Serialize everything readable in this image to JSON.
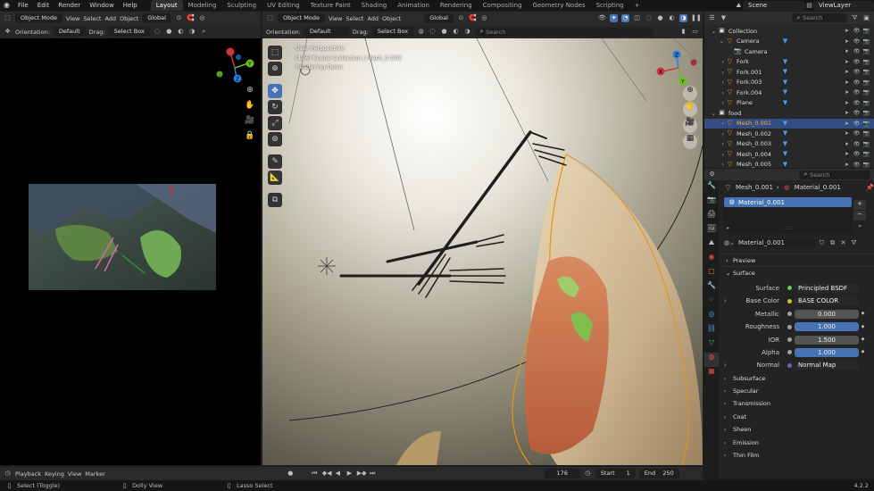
{
  "topbar": {
    "menus": [
      "File",
      "Edit",
      "Render",
      "Window",
      "Help"
    ],
    "workspaces": [
      "Layout",
      "Modeling",
      "Sculpting",
      "UV Editing",
      "Texture Paint",
      "Shading",
      "Animation",
      "Rendering",
      "Compositing",
      "Geometry Nodes",
      "Scripting"
    ],
    "active_workspace": "Layout",
    "add_tab": "+",
    "scene": "Scene",
    "view_layer": "ViewLayer"
  },
  "left_viewport": {
    "mode": "Object Mode",
    "menus": [
      "View",
      "Select",
      "Add",
      "Object"
    ],
    "transform_orientation": "Global",
    "orientation_label": "Orientation:",
    "orientation_value": "Default",
    "drag_label": "Drag:",
    "drag_value": "Select Box",
    "gizmo_axes": [
      "X",
      "Y",
      "Z"
    ]
  },
  "main_viewport": {
    "mode": "Object Mode",
    "menus": [
      "View",
      "Select",
      "Add",
      "Object"
    ],
    "transform_orientation": "Global",
    "orientation_label": "Orientation:",
    "orientation_value": "Default",
    "drag_label": "Drag:",
    "drag_value": "Select Box",
    "search_placeholder": "Search",
    "overlay_line1": "User Perspective",
    "overlay_line2": "(176) Scene Collection | Mesh_0.001",
    "overlay_line3": "Rendering Done",
    "gizmo_axes": [
      "X",
      "Y",
      "Z"
    ]
  },
  "outliner": {
    "search_placeholder": "Search",
    "rows": [
      {
        "label": "Collection",
        "indent": 1
      },
      {
        "label": "Camera",
        "indent": 2
      },
      {
        "label": "Camera",
        "indent": 3
      },
      {
        "label": "Fork",
        "indent": 2
      },
      {
        "label": "Fork.001",
        "indent": 2
      },
      {
        "label": "Fork.003",
        "indent": 2
      },
      {
        "label": "Fork.004",
        "indent": 2
      },
      {
        "label": "Plane",
        "indent": 2
      },
      {
        "label": "food",
        "indent": 1
      },
      {
        "label": "Mesh_0.001",
        "indent": 2,
        "selected": true
      },
      {
        "label": "Mesh_0.002",
        "indent": 2
      },
      {
        "label": "Mesh_0.003",
        "indent": 2
      },
      {
        "label": "Mesh_0.004",
        "indent": 2
      },
      {
        "label": "Mesh_0.005",
        "indent": 2
      }
    ]
  },
  "properties": {
    "search_placeholder": "Search",
    "breadcrumb_object": "Mesh_0.001",
    "breadcrumb_material": "Material_0.001",
    "slot_name": "Material_0.001",
    "material_name": "Material_0.001",
    "preview_label": "Preview",
    "surface_label": "Surface",
    "fields": [
      {
        "label": "Surface",
        "value": "Principled BSDF",
        "dot": "#63c763",
        "style": "dark"
      },
      {
        "label": "Base Color",
        "value": "BASE COLOR",
        "dot": "#c7c729",
        "style": "dark"
      },
      {
        "label": "Metallic",
        "value": "0.000",
        "dot": "#a1a1a1",
        "style": "grey"
      },
      {
        "label": "Roughness",
        "value": "1.000",
        "dot": "#a1a1a1",
        "style": "blue"
      },
      {
        "label": "IOR",
        "value": "1.500",
        "dot": "#a1a1a1",
        "style": "grey"
      },
      {
        "label": "Alpha",
        "value": "1.000",
        "dot": "#a1a1a1",
        "style": "blue"
      },
      {
        "label": "Normal",
        "value": "Normal Map",
        "dot": "#6363c7",
        "style": "dark"
      }
    ],
    "subpanels": [
      "Subsurface",
      "Specular",
      "Transmission",
      "Coat",
      "Sheen",
      "Emission",
      "Thin Film"
    ]
  },
  "timeline": {
    "menus": [
      "Playback",
      "Keying",
      "View",
      "Marker"
    ],
    "current_frame": "176",
    "start_label": "Start",
    "start_value": "1",
    "end_label": "End",
    "end_value": "250"
  },
  "statusbar": {
    "hint1": "Select (Toggle)",
    "hint2": "Dolly View",
    "hint3": "Lasso Select",
    "version": "4.2.2"
  }
}
